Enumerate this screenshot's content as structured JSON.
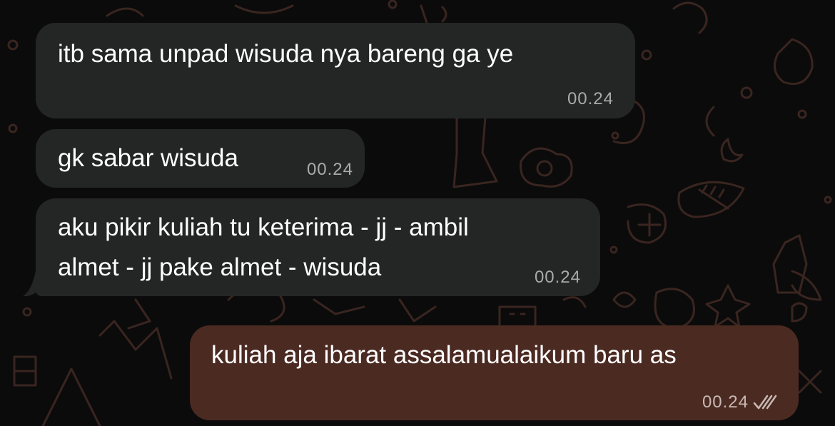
{
  "chat": {
    "messages": [
      {
        "direction": "incoming",
        "text": "itb sama unpad wisuda nya bareng ga ye",
        "time": "00.24"
      },
      {
        "direction": "incoming",
        "text": "gk sabar wisuda",
        "time": "00.24"
      },
      {
        "direction": "incoming",
        "lines": [
          "aku pikir kuliah tu keterima - jj - ambil",
          "almet - jj pake almet - wisuda"
        ],
        "time": "00.24"
      },
      {
        "direction": "outgoing",
        "text": "kuliah aja ibarat assalamualaikum baru as",
        "time": "00.24",
        "status": "read-double-check-icon"
      }
    ]
  },
  "colors": {
    "background": "#0b0b0b",
    "incoming_bubble": "#242626",
    "outgoing_bubble": "#4b2a22",
    "doodle": "#3a2520"
  }
}
